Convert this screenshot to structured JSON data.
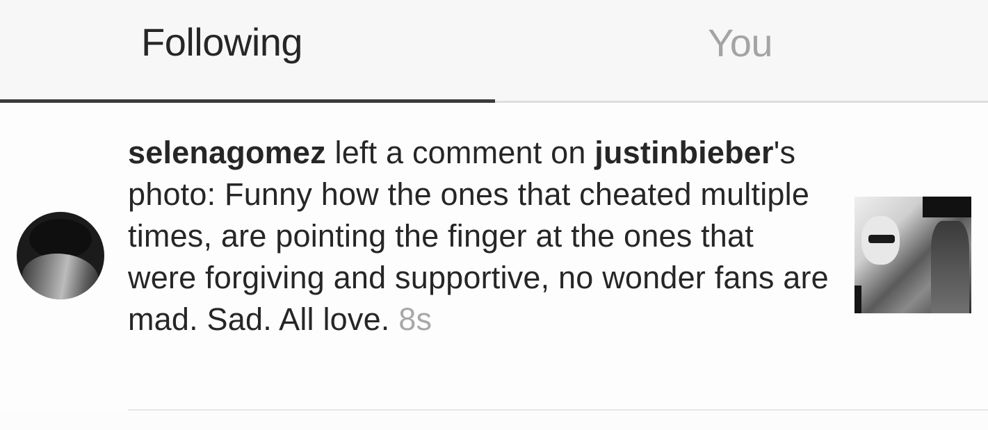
{
  "tabs": {
    "following_label": "Following",
    "you_label": "You",
    "active": "Following"
  },
  "activity": {
    "actor_username": "selenagomez",
    "action_text": " left a comment on ",
    "target_username": "justinbieber",
    "target_suffix": "'s photo: ",
    "comment_text": "Funny how the ones that cheated multiple times, are pointing the finger at the ones that were forgiving and supportive, no wonder fans are mad. Sad. All love.",
    "timestamp": "8s"
  },
  "colors": {
    "text_primary": "#262626",
    "text_muted": "#a4a4a4",
    "active_tab_underline": "#3b3b3b",
    "divider": "#e6e6e6"
  }
}
